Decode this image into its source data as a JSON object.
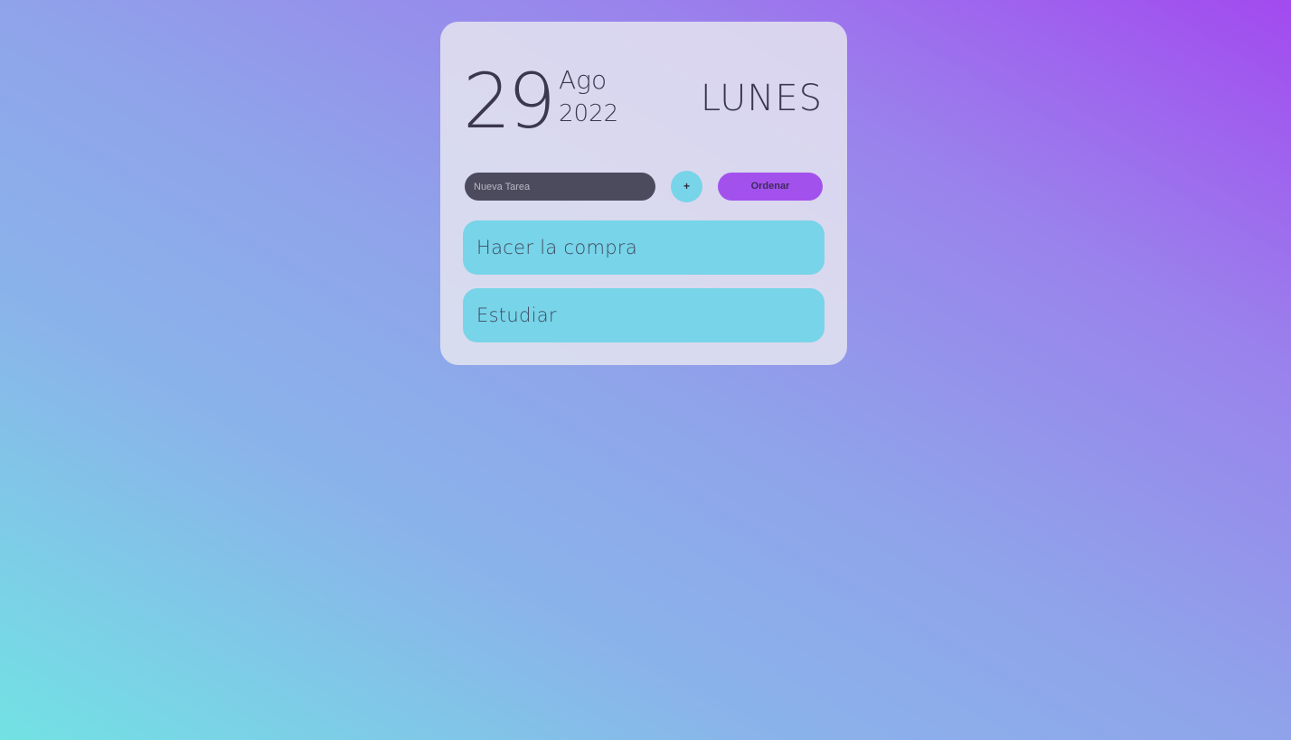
{
  "date": {
    "day": "29",
    "month": "Ago",
    "year": "2022",
    "weekday": "LUNES"
  },
  "controls": {
    "input_placeholder": "Nueva Tarea",
    "input_value": "",
    "add_label": "+",
    "sort_label": "Ordenar"
  },
  "tasks": [
    {
      "text": "Hacer la compra"
    },
    {
      "text": "Estudiar"
    }
  ],
  "colors": {
    "card_background": "#e1e1ef",
    "input_background": "#4c4b5e",
    "add_button": "#78d4e8",
    "sort_button": "#a351ed",
    "task_background": "#78d4e8",
    "text_dark": "#3b3750"
  }
}
